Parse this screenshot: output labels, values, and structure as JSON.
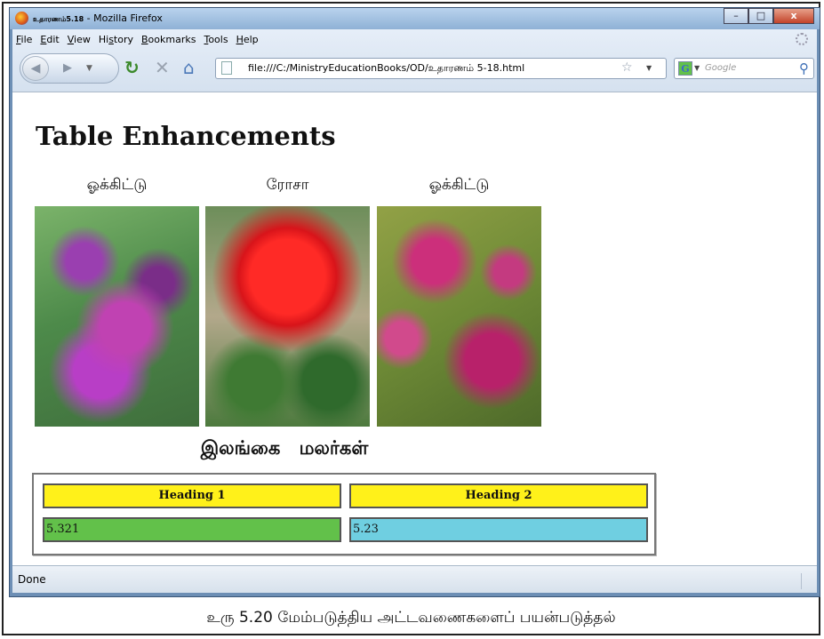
{
  "window": {
    "title_prefix": "உதாரணம்5.18",
    "title": " - Mozilla Firefox",
    "controls": {
      "minimize": "–",
      "maximize": "□",
      "close": "x"
    }
  },
  "menu": [
    {
      "pre": "",
      "key": "F",
      "post": "ile"
    },
    {
      "pre": "",
      "key": "E",
      "post": "dit"
    },
    {
      "pre": "",
      "key": "V",
      "post": "iew"
    },
    {
      "pre": "Hi",
      "key": "s",
      "post": "tory"
    },
    {
      "pre": "",
      "key": "B",
      "post": "ookmarks"
    },
    {
      "pre": "",
      "key": "T",
      "post": "ools"
    },
    {
      "pre": "",
      "key": "H",
      "post": "elp"
    }
  ],
  "navigation": {
    "url": "file:///C:/MinistryEducationBooks/OD/உதாரணம் 5-18.html",
    "search_placeholder": "Google",
    "search_engine_letter": "G"
  },
  "page": {
    "heading": "Table Enhancements",
    "images": [
      {
        "caption": "ஓக்கிட்டு",
        "icon": "orchid-photo"
      },
      {
        "caption": "ரோசா",
        "icon": "rose-photo"
      },
      {
        "caption": "ஓக்கிட்டு",
        "icon": "orchid-photo"
      }
    ],
    "table_caption": "இலங்கை மலர்கள்",
    "table": {
      "headers": [
        "Heading 1",
        "Heading 2"
      ],
      "row": [
        "5.321",
        "5.23"
      ],
      "colors": {
        "header": "#fff11a",
        "cell1": "#62c14a",
        "cell2": "#6fcfe1"
      }
    }
  },
  "status": "Done",
  "figure_caption": "உரு 5.20 மேம்படுத்திய அட்டவணைகளைப் பயன்படுத்தல்"
}
